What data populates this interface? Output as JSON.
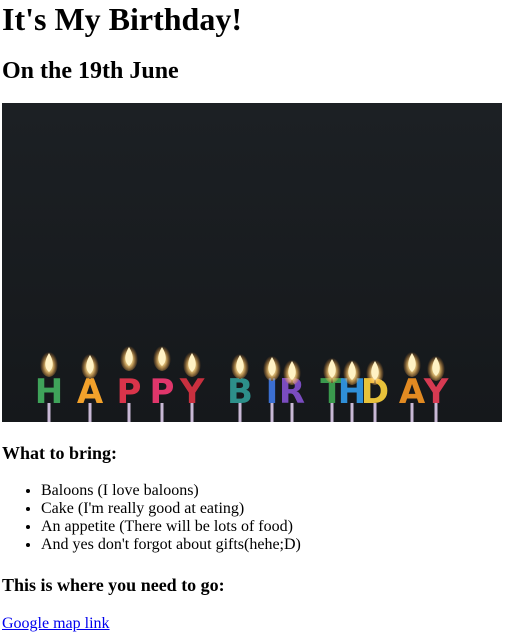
{
  "page": {
    "title": "It's My Birthday!",
    "subtitle": "On the 19th June",
    "image_alt": "Happy birthday candles",
    "candle_letters": [
      "H",
      "A",
      "P",
      "P",
      "Y",
      "B",
      "I",
      "R",
      "T",
      "H",
      "D",
      "A",
      "Y"
    ],
    "candle_colors": [
      "#3fa35a",
      "#f2a12b",
      "#d9344a",
      "#e0366b",
      "#c9303f",
      "#2d8f8a",
      "#3b6fd1",
      "#7a4cc0",
      "#3a9a4d",
      "#2f8fd8",
      "#e8c23a",
      "#e18a22",
      "#d63a52"
    ],
    "bring_heading": "What to bring:",
    "bring_items": [
      "Baloons (I love baloons)",
      "Cake (I'm really good at eating)",
      "An appetite (There will be lots of food)",
      "And yes don't forgot about gifts(hehe;D)"
    ],
    "location_heading": "This is where you need to go:",
    "map_link_text": "Google map link"
  }
}
